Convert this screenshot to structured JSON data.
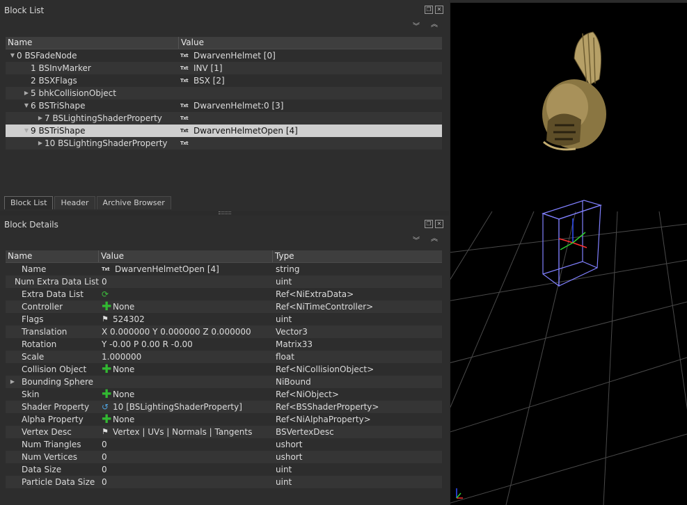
{
  "block_list": {
    "title": "Block List",
    "columns": [
      "Name",
      "Value"
    ],
    "rows": [
      {
        "name": "0 BSFadeNode",
        "value": "DwarvenHelmet [0]",
        "indent": 0,
        "expander": "open",
        "txt": true
      },
      {
        "name": "1 BSInvMarker",
        "value": "INV [1]",
        "indent": 1,
        "expander": "none",
        "txt": true
      },
      {
        "name": "2 BSXFlags",
        "value": "BSX [2]",
        "indent": 1,
        "expander": "none",
        "txt": true
      },
      {
        "name": "5 bhkCollisionObject",
        "value": "",
        "indent": 1,
        "expander": "closed",
        "txt": false
      },
      {
        "name": "6 BSTriShape",
        "value": "DwarvenHelmet:0 [3]",
        "indent": 1,
        "expander": "open",
        "txt": true
      },
      {
        "name": "7 BSLightingShaderProperty",
        "value": "",
        "indent": 2,
        "expander": "closed",
        "txt": true
      },
      {
        "name": "9 BSTriShape",
        "value": "DwarvenHelmetOpen [4]",
        "indent": 1,
        "expander": "open",
        "txt": true,
        "selected": true
      },
      {
        "name": "10 BSLightingShaderProperty",
        "value": "",
        "indent": 2,
        "expander": "closed",
        "txt": true
      }
    ],
    "txt_icon_label": "Txt"
  },
  "tabs": [
    "Block List",
    "Header",
    "Archive Browser"
  ],
  "block_details": {
    "title": "Block Details",
    "columns": [
      "Name",
      "Value",
      "Type"
    ],
    "rows": [
      {
        "name": "Name",
        "value": "DwarvenHelmetOpen [4]",
        "type": "string",
        "icon": "txt"
      },
      {
        "name": "Num Extra Data List",
        "value": "0",
        "type": "uint",
        "icon": ""
      },
      {
        "name": "Extra Data List",
        "value": "",
        "type": "Ref<NiExtraData>",
        "icon": "cycle"
      },
      {
        "name": "Controller",
        "value": "None",
        "type": "Ref<NiTimeController>",
        "icon": "plus"
      },
      {
        "name": "Flags",
        "value": "524302",
        "type": "uint",
        "icon": "flag"
      },
      {
        "name": "Translation",
        "value": "X 0.000000 Y 0.000000 Z 0.000000",
        "type": "Vector3",
        "icon": ""
      },
      {
        "name": "Rotation",
        "value": "Y -0.00 P 0.00 R -0.00",
        "type": "Matrix33",
        "icon": ""
      },
      {
        "name": "Scale",
        "value": "1.000000",
        "type": "float",
        "icon": ""
      },
      {
        "name": "Collision Object",
        "value": "None",
        "type": "Ref<NiCollisionObject>",
        "icon": "plus"
      },
      {
        "name": "Bounding Sphere",
        "value": "",
        "type": "NiBound",
        "icon": "",
        "expander": "closed"
      },
      {
        "name": "Skin",
        "value": "None",
        "type": "Ref<NiObject>",
        "icon": "plus"
      },
      {
        "name": "Shader Property",
        "value": "10 [BSLightingShaderProperty]",
        "type": "Ref<BSShaderProperty>",
        "icon": "link"
      },
      {
        "name": "Alpha Property",
        "value": "None",
        "type": "Ref<NiAlphaProperty>",
        "icon": "plus"
      },
      {
        "name": "Vertex Desc",
        "value": "Vertex | UVs | Normals | Tangents",
        "type": "BSVertexDesc",
        "icon": "flag"
      },
      {
        "name": "Num Triangles",
        "value": "0",
        "type": "ushort",
        "icon": ""
      },
      {
        "name": "Num Vertices",
        "value": "0",
        "type": "ushort",
        "icon": ""
      },
      {
        "name": "Data Size",
        "value": "0",
        "type": "uint",
        "icon": ""
      },
      {
        "name": "Particle Data Size",
        "value": "0",
        "type": "uint",
        "icon": ""
      }
    ]
  },
  "colors": {
    "selection": "#cfcfcf",
    "bbox": "#8080ff",
    "grid": "#4a4a4a"
  }
}
